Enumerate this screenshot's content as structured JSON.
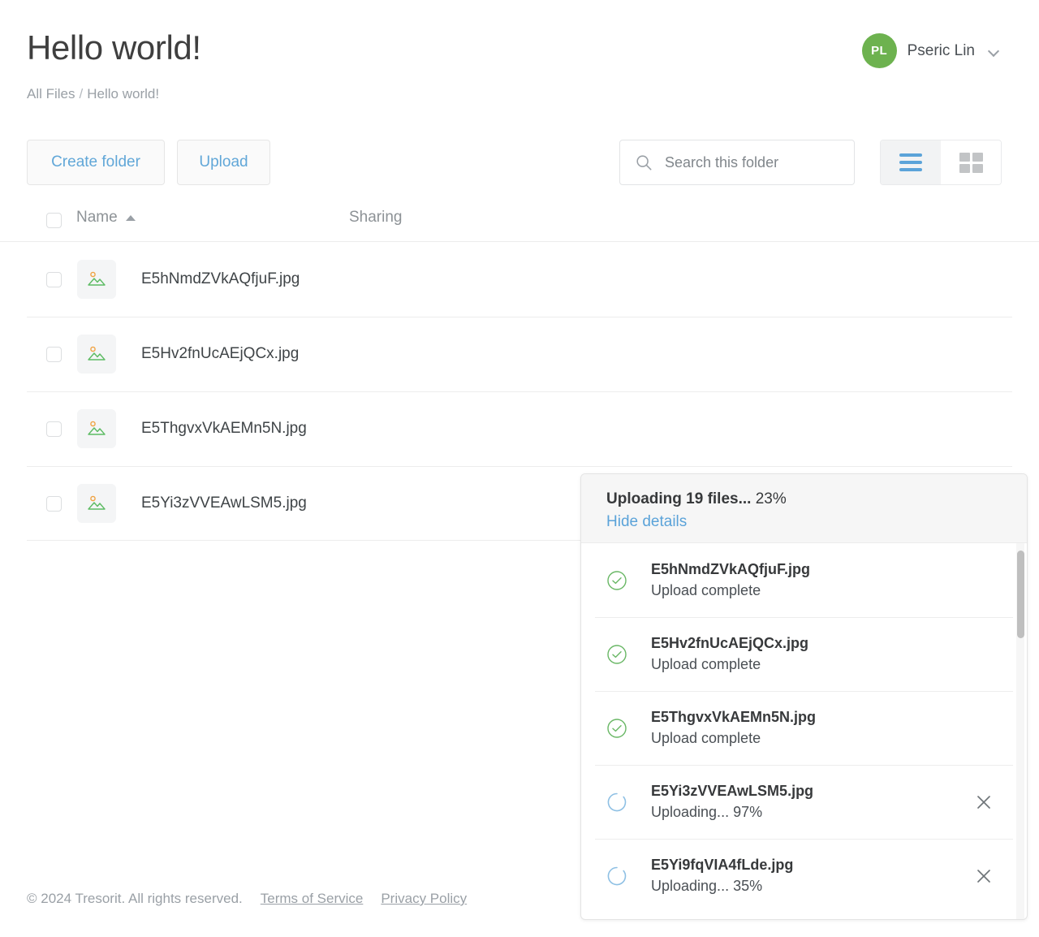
{
  "header": {
    "title": "Hello world!",
    "breadcrumb": {
      "root": "All Files",
      "separator": "/",
      "current": "Hello world!"
    },
    "user": {
      "initials": "PL",
      "name": "Pseric Lin",
      "avatar_color": "#6db24f",
      "caret_icon": "chevron-down-icon"
    }
  },
  "toolbar": {
    "create_folder_label": "Create folder",
    "upload_label": "Upload",
    "search": {
      "placeholder": "Search this folder",
      "value": "",
      "icon": "search-icon"
    },
    "view": {
      "list_icon": "list-view-icon",
      "grid_icon": "grid-view-icon",
      "active": "list"
    }
  },
  "table": {
    "columns": {
      "name": "Name",
      "sharing": "Sharing"
    },
    "sort": {
      "column": "Name",
      "direction": "ascending",
      "icon": "sort-ascending-icon"
    },
    "select_all_checked": false,
    "rows": [
      {
        "name": "E5hNmdZVkAQfjuF.jpg",
        "icon": "image-file-icon",
        "sharing": "",
        "checked": false
      },
      {
        "name": "E5Hv2fnUcAEjQCx.jpg",
        "icon": "image-file-icon",
        "sharing": "",
        "checked": false
      },
      {
        "name": "E5ThgvxVkAEMn5N.jpg",
        "icon": "image-file-icon",
        "sharing": "",
        "checked": false
      },
      {
        "name": "E5Yi3zVVEAwLSM5.jpg",
        "icon": "image-file-icon",
        "sharing": "",
        "checked": false
      }
    ]
  },
  "upload_panel": {
    "title_bold": "Uploading 19 files...",
    "title_percent": "23%",
    "file_count": 19,
    "overall_percent": "23%",
    "hide_details_label": "Hide details",
    "items": [
      {
        "name": "E5hNmdZVkAQfjuF.jpg",
        "status": "Upload complete",
        "state": "complete",
        "icon": "check-circle-icon",
        "cancel_icon": null
      },
      {
        "name": "E5Hv2fnUcAEjQCx.jpg",
        "status": "Upload complete",
        "state": "complete",
        "icon": "check-circle-icon",
        "cancel_icon": null
      },
      {
        "name": "E5ThgvxVkAEMn5N.jpg",
        "status": "Upload complete",
        "state": "complete",
        "icon": "check-circle-icon",
        "cancel_icon": null
      },
      {
        "name": "E5Yi3zVVEAwLSM5.jpg",
        "status": "Uploading... 97%",
        "state": "uploading",
        "icon": "spinner-icon",
        "cancel_icon": "close-icon"
      },
      {
        "name": "E5Yi9fqVIA4fLde.jpg",
        "status": "Uploading... 35%",
        "state": "uploading",
        "icon": "spinner-icon",
        "cancel_icon": "close-icon"
      }
    ]
  },
  "footer": {
    "copyright": "© 2024 Tresorit. All rights reserved.",
    "terms_label": "Terms of Service",
    "privacy_label": "Privacy Policy"
  },
  "colors": {
    "accent_blue": "#5ba3d9",
    "link_blue": "#61a7d8",
    "avatar_green": "#6db24f",
    "success_green": "#69b765",
    "icon_orange": "#f0a343",
    "icon_green": "#5dbb63",
    "muted_text": "#9aa0a6"
  }
}
